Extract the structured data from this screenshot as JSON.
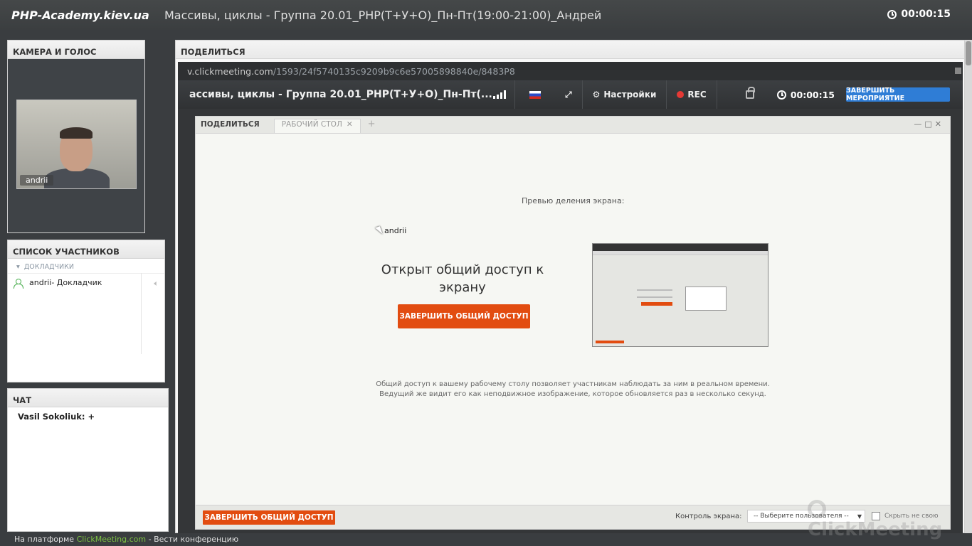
{
  "topbar": {
    "brand": "PHP-Academy.kiev.ua",
    "title": "Массивы, циклы - Группа 20.01_PHP(Т+У+О)_Пн-Пт(19:00-21:00)_Андрей",
    "timer": "00:00:15"
  },
  "camera": {
    "heading": "КАМЕРА И ГОЛОС",
    "user": "andrii"
  },
  "participants": {
    "heading": "СПИСОК УЧАСТНИКОВ",
    "group": "ДОКЛАДЧИКИ",
    "items": [
      {
        "name": "andrii",
        "role": " - Докладчик"
      }
    ]
  },
  "chat": {
    "heading": "ЧАТ",
    "messages": [
      {
        "author": "Vasil Sokoliuk:",
        "text": " +"
      }
    ]
  },
  "share": {
    "heading": "ПОДЕЛИТЬСЯ",
    "url_prefix": "v.clickmeeting.com",
    "url_path": "/1593/24f5740135c9209b9c6e57005898840e/8483P8",
    "toolbar": {
      "title": "ассивы, циклы - Группа 20.01_PHP(Т+У+О)_Пн-Пт(...",
      "settings": "Настройки",
      "rec": "REC",
      "timer": "00:00:15",
      "end_event": "ЗАВЕРШИТЬ МЕРОПРИЯТИЕ"
    },
    "inner": {
      "tab_label": "ПОДЕЛИТЬСЯ",
      "tab_desktop": "РАБОЧИЙ СТОЛ",
      "preview_label": "Превью деления экрана:",
      "cursor_user": "andrii",
      "open_title": "Открыт общий доступ к экрану",
      "stop_button": "ЗАВЕРШИТЬ ОБЩИЙ ДОСТУП",
      "description": "Общий доступ к вашему рабочему столу позволяет участникам наблюдать за ним в реальном времени. Ведущий же видит его как неподвижное изображение, которое обновляется раз в несколько секунд.",
      "footer_stop_button": "ЗАВЕРШИТЬ ОБЩИЙ ДОСТУП",
      "screen_control_label": "Контроль экрана:",
      "select_placeholder": "-- Выберите пользователя --",
      "checkbox_label": "Скрыть не свою",
      "watermark": "ClickMeeting"
    }
  },
  "footer": {
    "prefix": "На платформе ",
    "link": "ClickMeeting.com",
    "suffix": " - Вести конференцию"
  },
  "colors": {
    "orange": "#e24c10",
    "blue": "#2f7dd6",
    "green": "#7cc142"
  }
}
